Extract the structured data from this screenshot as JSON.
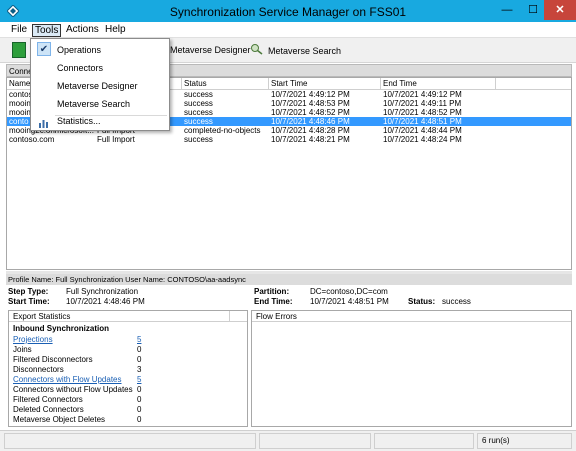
{
  "window": {
    "title": "Synchronization Service Manager on FSS01",
    "min_label": "—",
    "max_label": "☐",
    "close_label": "✕"
  },
  "menubar": {
    "file": "File",
    "tools": "Tools",
    "actions": "Actions",
    "help": "Help"
  },
  "toolbar": {
    "metaverse_designer": "Metaverse Designer",
    "metaverse_search": "Metaverse Search"
  },
  "tools_menu": {
    "items": [
      "Operations",
      "Connectors",
      "Metaverse Designer",
      "Metaverse Search",
      "Statistics..."
    ],
    "checked": "Operations"
  },
  "connectors_header": "Conne",
  "grid": {
    "columns": [
      "Name",
      "",
      "Status",
      "Start Time",
      "End Time",
      ""
    ],
    "rows": [
      {
        "name": "contos",
        "profile": "",
        "status": "success",
        "start": "10/7/2021 4:49:12 PM",
        "end": "10/7/2021 4:49:12 PM",
        "selected": false
      },
      {
        "name": "mooin",
        "profile": "",
        "status": "success",
        "start": "10/7/2021 4:48:53 PM",
        "end": "10/7/2021 4:49:11 PM",
        "selected": false
      },
      {
        "name": "mooin",
        "profile": "",
        "status": "success",
        "start": "10/7/2021 4:48:52 PM",
        "end": "10/7/2021 4:48:52 PM",
        "selected": false
      },
      {
        "name": "conto",
        "profile": "",
        "status": "success",
        "start": "10/7/2021 4:48:46 PM",
        "end": "10/7/2021 4:48:51 PM",
        "selected": true
      },
      {
        "name": "mooing2c.onmicrosoft...",
        "profile": "Full Import",
        "status": "completed-no-objects",
        "start": "10/7/2021 4:48:28 PM",
        "end": "10/7/2021 4:48:44 PM",
        "selected": false
      },
      {
        "name": "contoso.com",
        "profile": "Full Import",
        "status": "success",
        "start": "10/7/2021 4:48:21 PM",
        "end": "10/7/2021 4:48:24 PM",
        "selected": false
      }
    ]
  },
  "profile": {
    "header": "Profile Name: Full Synchronization  User Name: CONTOSO\\aa-aadsync",
    "step_type_label": "Step Type:",
    "step_type": "Full Synchronization",
    "start_time_label": "Start Time:",
    "start_time": "10/7/2021 4:48:46 PM",
    "partition_label": "Partition:",
    "partition": "DC=contoso,DC=com",
    "end_time_label": "End Time:",
    "end_time": "10/7/2021 4:48:51 PM",
    "status_label": "Status:",
    "status": "success"
  },
  "stats": {
    "header": "Export Statistics",
    "section": "Inbound Synchronization",
    "rows": [
      {
        "label": "Projections",
        "value": "5",
        "link": true
      },
      {
        "label": "Joins",
        "value": "0",
        "link": false
      },
      {
        "label": "Filtered Disconnectors",
        "value": "0",
        "link": false
      },
      {
        "label": "Disconnectors",
        "value": "3",
        "link": false
      },
      {
        "label": "Connectors with Flow Updates",
        "value": "5",
        "link": true
      },
      {
        "label": "Connectors without Flow Updates",
        "value": "0",
        "link": false
      },
      {
        "label": "Filtered Connectors",
        "value": "0",
        "link": false
      },
      {
        "label": "Deleted Connectors",
        "value": "0",
        "link": false
      },
      {
        "label": "Metaverse Object Deletes",
        "value": "0",
        "link": false
      }
    ]
  },
  "flow_errors": {
    "header": "Flow Errors"
  },
  "statusbar": {
    "runs": "6 run(s)"
  },
  "colors": {
    "titlebar": "#18a9e0",
    "selection": "#3399ff",
    "close": "#c7453b",
    "link": "#1a5fb4"
  }
}
